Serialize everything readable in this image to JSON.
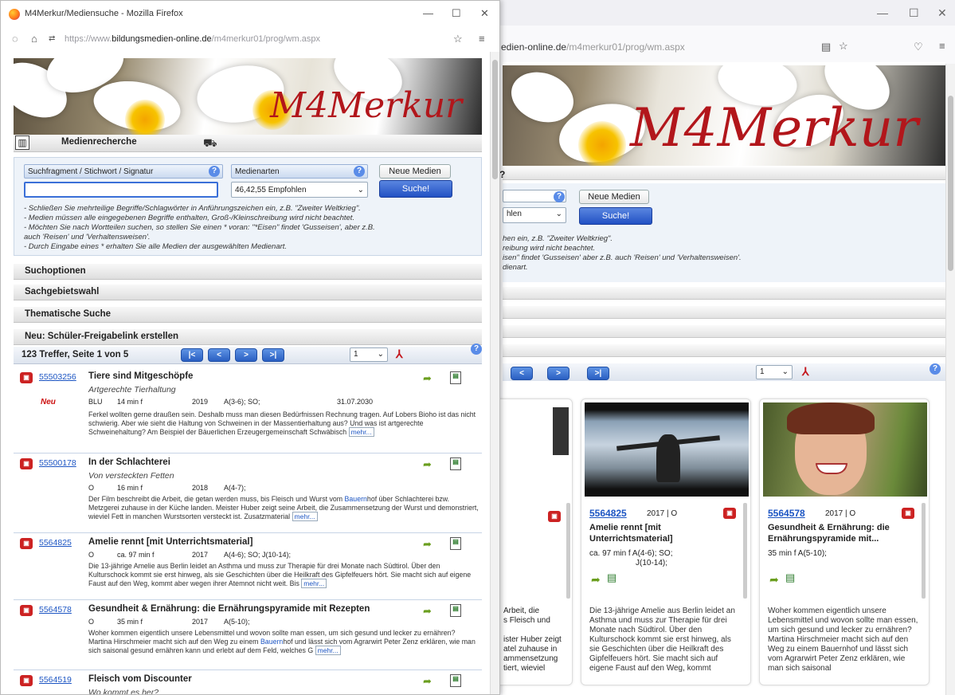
{
  "back_window": {
    "url_main": "edien-online.de",
    "url_rest": "/m4merkur01/prog/wm.aspx",
    "banner_brand": "M4Merkur",
    "new_media_button": "Neue Medien",
    "search_button": "Suche!",
    "select_partial": "hlen",
    "hints": [
      "hen ein, z.B. \"Zweiter Weltkrieg\".",
      "reibung wird nicht beachtet.",
      "isen\" findet 'Gusseisen' aber z.B. auch 'Reisen' und 'Verhaltensweisen'.",
      "dienart."
    ],
    "page_select": "1",
    "partial_card_text": [
      "Arbeit, die",
      "s Fleisch und",
      "ister Huber zeigt",
      "atel zuhause in",
      "ammensetzung",
      "tiert, wieviel"
    ],
    "cards": [
      {
        "id": "5564825",
        "year_cat": "2017 | O",
        "title": "Amelie rennt [mit Unterrichtsmaterial]",
        "meta_line1": "ca. 97 min f   A(4-6); SO;",
        "meta_line2": "J(10-14);",
        "desc": "Die 13-jährige Amelie aus Berlin leidet an Asthma und muss zur Therapie für drei Monate nach Südtirol. Über den Kulturschock kommt sie erst hinweg, als sie Geschichten über die Heilkraft des Gipfelfeuers hört. Sie macht sich auf eigene Faust auf den Weg, kommt"
      },
      {
        "id": "5564578",
        "year_cat": "2017 | O",
        "title": "Gesundheit & Ernährung: die Ernährungspyramide mit...",
        "meta_line1": "35 min f        A(5-10);",
        "meta_line2": "",
        "desc": "Woher kommen eigentlich unsere Lebensmittel und wovon sollte man essen, um sich gesund und lecker zu ernähren? Martina Hirschmeier macht sich auf den Weg zu einem Bauernhof und lässt sich vom Agrarwirt Peter Zenz erklären, wie man sich saisonal"
      }
    ]
  },
  "front_window": {
    "title": "M4Merkur/Mediensuche - Mozilla Firefox",
    "url_main": "bildungsmedien-online.de",
    "url_prefix": "https://www.",
    "url_rest": "/m4merkur01/prog/wm.aspx",
    "banner_brand": "M4Merkur",
    "header_label": "Medienrecherche",
    "search_field_label": "Suchfragment / Stichwort / Signatur",
    "search_value": "",
    "media_label": "Medienarten",
    "media_select": "46,42,55 Empfohlen",
    "new_media_button": "Neue Medien",
    "search_button": "Suche!",
    "hints": [
      "- Schließen Sie mehrteilige Begriffe/Schlagwörter in Anführungszeichen ein, z.B. \"Zweiter Weltkrieg\".",
      "- Medien müssen alle eingegebenen Begriffe enthalten, Groß-/Kleinschreibung wird nicht beachtet.",
      "- Möchten Sie nach Wortteilen suchen, so stellen Sie einen * voran: \"*Eisen\" findet 'Gusseisen', aber z.B.",
      "  auch 'Reisen' und 'Verhaltensweisen'.",
      "- Durch Eingabe eines * erhalten Sie alle Medien der ausgewählten Medienart."
    ],
    "sections": [
      "Suchoptionen",
      "Sachgebietswahl",
      "Thematische Suche",
      "Neu: Schüler-Freigabelink erstellen"
    ],
    "hits_label": "123 Treffer, Seite 1 von 5",
    "page_select": "1",
    "nav_first": "|<",
    "nav_prev": "<",
    "nav_next": ">",
    "nav_last": ">|",
    "results": [
      {
        "id": "55503256",
        "title": "Tiere sind Mitgeschöpfe",
        "subtitle": "Artgerechte Tierhaltung",
        "neu": "Neu",
        "m_type": "BLU",
        "m_dur": "14 min f",
        "m_year": "2019",
        "m_age": "A(3-6); SO;",
        "m_date": "31.07.2030",
        "desc_pre": "Ferkel wollten gerne draußen sein. Deshalb muss man diesen Bedürfnissen Rechnung tragen. Auf Lobers Bioho ist das nicht schwierig. Aber wie sieht die Haltung von Schweinen in der Massentierhaltung aus? Und was ist artgerechte Schweinehaltung? Am Beispiel der Bäuerlichen Erzeugergemeinschaft Schwäbisch ",
        "more": "mehr..."
      },
      {
        "id": "55500178",
        "title": "In der Schlachterei",
        "subtitle": "Von versteckten Fetten",
        "neu": "",
        "m_type": "O",
        "m_dur": "16 min f",
        "m_year": "2018",
        "m_age": "A(4-7);",
        "m_date": "",
        "desc_pre": "Der Film beschreibt die Arbeit, die getan werden muss, bis Fleisch und Wurst vom ",
        "desc_link": "Bauern",
        "desc_post": "hof über Schlachterei bzw. Metzgerei zuhause in der Küche landen. Meister Huber zeigt seine Arbeit, die Zusammensetzung der Wurst und demonstriert, wieviel Fett in manchen Wurstsorten versteckt ist. Zusatzmaterial ",
        "more": "mehr..."
      },
      {
        "id": "5564825",
        "title": "Amelie rennt [mit Unterrichtsmaterial]",
        "subtitle": "",
        "neu": "",
        "m_type": "O",
        "m_dur": "ca. 97 min f",
        "m_year": "2017",
        "m_age": "A(4-6); SO; J(10-14);",
        "m_date": "",
        "desc_pre": "Die 13-jährige Amelie aus Berlin leidet an Asthma und muss zur Therapie für drei Monate nach Südtirol. Über den Kulturschock kommt sie erst hinweg, als sie Geschichten über die Heilkraft des Gipfelfeuers hört. Sie macht sich auf eigene Faust auf den Weg, kommt aber wegen ihrer Atemnot nicht weit. Bis ",
        "more": "mehr..."
      },
      {
        "id": "5564578",
        "title": "Gesundheit & Ernährung: die Ernährungspyramide mit Rezepten",
        "subtitle": "",
        "neu": "",
        "m_type": "O",
        "m_dur": "35 min f",
        "m_year": "2017",
        "m_age": "A(5-10);",
        "m_date": "",
        "desc_pre": "Woher kommen eigentlich unsere Lebensmittel und wovon sollte man essen, um sich gesund und lecker zu ernähren? Martina Hirschmeier macht sich auf den Weg zu einem ",
        "desc_link": "Bauern",
        "desc_post": "hof und lässt sich vom Agrarwirt Peter Zenz erklären, wie man sich saisonal gesund ernähren kann und erlebt auf dem Feld, welches G ",
        "more": "mehr..."
      },
      {
        "id": "5564519",
        "title": "Fleisch vom Discounter",
        "subtitle": "Wo kommt es her?",
        "neu": "",
        "m_type": "",
        "m_dur": "",
        "m_year": "",
        "m_age": "",
        "m_date": "",
        "desc_pre": "",
        "more": ""
      }
    ]
  }
}
